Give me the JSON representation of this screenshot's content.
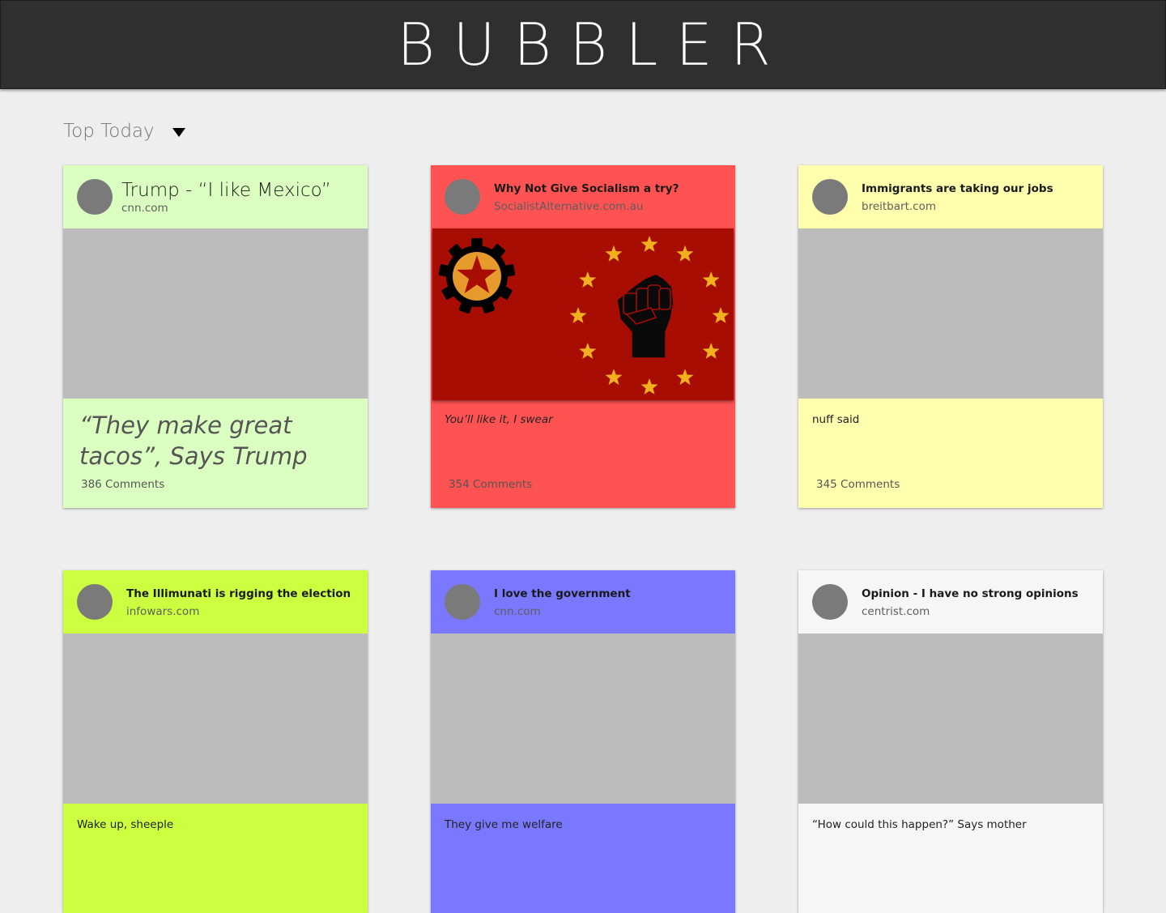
{
  "app": {
    "title": "BUBBLER"
  },
  "sort": {
    "label": "Top Today"
  },
  "cards": [
    {
      "title": "Trump - “I like Mexico”",
      "source": "cnn.com",
      "description": "“They make great tacos”, Says Trump",
      "comments": "386 Comments",
      "head_color": "#dbffc1",
      "body_color": "#dbffc1"
    },
    {
      "title": "Why Not Give Socialism a try?",
      "source": "SocialistAlternative.com.au",
      "description": "You’ll like it, I swear",
      "comments": "354 Comments",
      "head_color": "#ff5252",
      "body_color": "#ff5252",
      "image": "socialist-flag-image"
    },
    {
      "title": "Immigrants are taking our jobs",
      "source": "breitbart.com",
      "description": "nuff said",
      "comments": "345 Comments",
      "head_color": "#ffffad",
      "body_color": "#ffffad"
    },
    {
      "title": "The Illimunati is rigging the election",
      "source": "infowars.com",
      "description": "Wake up, sheeple",
      "comments": "",
      "head_color": "#ccff40",
      "body_color": "#ccff40"
    },
    {
      "title": "I love the government",
      "source": "cnn.com",
      "description": "They give me welfare",
      "comments": "",
      "head_color": "#7a78ff",
      "body_color": "#7a78ff"
    },
    {
      "title": "Opinion - I have no strong opinions",
      "source": "centrist.com",
      "description": "“How could this happen?” Says mother",
      "comments": "",
      "head_color": "#f6f6f6",
      "body_color": "#f6f6f6"
    }
  ]
}
